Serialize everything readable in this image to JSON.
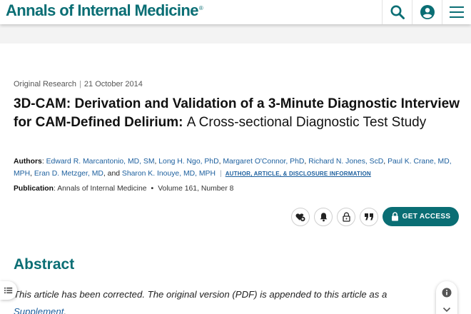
{
  "header": {
    "logo_text": "Annals of Internal Medicine",
    "logo_mark": "®",
    "brand_color": "#0a6e74",
    "icons": [
      "search-icon",
      "account-icon",
      "menu-icon"
    ]
  },
  "article": {
    "type": "Original Research",
    "date": "21 October 2014",
    "title_main": "3D-CAM: Derivation and Validation of a 3-Minute Diagnostic Interview for CAM-Defined Delirium:",
    "title_sub": "A Cross-sectional Diagnostic Test Study",
    "authors_label": "Authors",
    "authors": [
      "Edward R. Marcantonio, MD, SM",
      "Long H. Ngo, PhD",
      "Margaret O'Connor, PhD",
      "Richard N. Jones, ScD",
      "Paul K. Crane, MD, MPH",
      "Eran D. Metzger, MD",
      "Sharon K. Inouye, MD, MPH"
    ],
    "authors_and": "and",
    "author_info_link": "AUTHOR, ARTICLE, & DISCLOSURE INFORMATION",
    "publication_label": "Publication",
    "journal": "Annals of Internal Medicine",
    "volume": "Volume 161, Number 8"
  },
  "actions": {
    "icons": [
      "heart-add-icon",
      "bell-icon",
      "unlock-icon",
      "quote-icon"
    ],
    "get_access_label": "GET ACCESS",
    "get_access_icon": "lock-icon"
  },
  "abstract": {
    "heading": "Abstract",
    "correction_text": "This article has been corrected. The original version (PDF) is appended to this article as a",
    "supplement_link": "Supplement",
    "correction_end": "."
  },
  "floating": {
    "toc_icon": "list-icon",
    "info_icon": "info-icon",
    "chevron_icon": "chevron-down-icon"
  }
}
